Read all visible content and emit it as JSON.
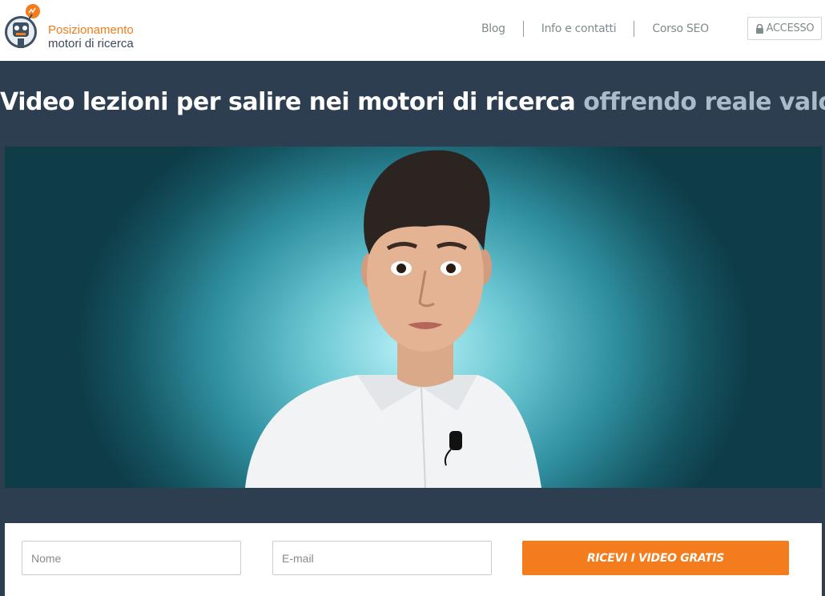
{
  "logo": {
    "line1": "Posizionamento",
    "line2": "motori di ricerca"
  },
  "nav": {
    "items": [
      {
        "label": "Blog"
      },
      {
        "label": "Info e contatti"
      },
      {
        "label": "Corso SEO"
      }
    ],
    "access_label": "ACCESSO"
  },
  "hero": {
    "title_main": "Video lezioni per salire nei motori di ricerca",
    "title_accent": "offrendo reale valore"
  },
  "form": {
    "name_placeholder": "Nome",
    "email_placeholder": "E-mail",
    "submit_label": "RICEVI I VIDEO GRATIS"
  },
  "colors": {
    "brand_orange": "#f47c1c",
    "header_bg": "#ffffff",
    "page_bg": "#2c3e50",
    "accent_text": "#a9bccb"
  }
}
